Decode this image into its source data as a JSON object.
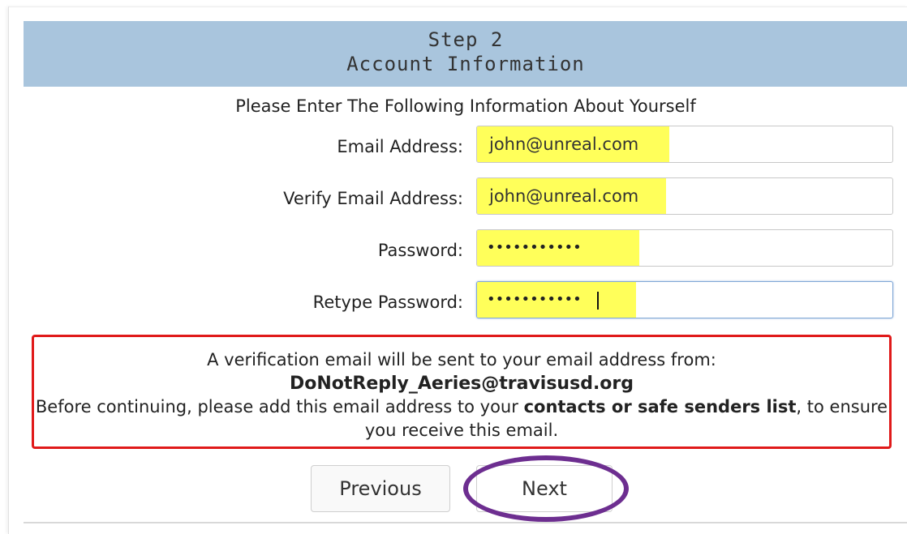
{
  "header": {
    "step": "Step 2",
    "title": "Account Information"
  },
  "intro": "Please Enter The Following Information About Yourself",
  "form": {
    "email_label": "Email Address:",
    "email_value": "john@unreal.com",
    "verify_label": "Verify Email Address:",
    "verify_value": "john@unreal.com",
    "password_label": "Password:",
    "password_value": "•••••••••••",
    "retype_label": "Retype Password:",
    "retype_value": "•••••••••••"
  },
  "notice": {
    "line1": "A verification email will be sent to your email address from:",
    "email": "DoNotReply_Aeries@travisusd.org",
    "line3_pre": "Before continuing, please add this email address to your ",
    "line3_bold": "contacts or safe senders list",
    "line3_post": ", to ensure you receive this email."
  },
  "buttons": {
    "previous": "Previous",
    "next": "Next"
  },
  "colors": {
    "header_bg": "#a9c5dd",
    "highlight": "#ffff5a",
    "notice_border": "#e01a1a",
    "annotation_oval": "#6d2e90"
  }
}
